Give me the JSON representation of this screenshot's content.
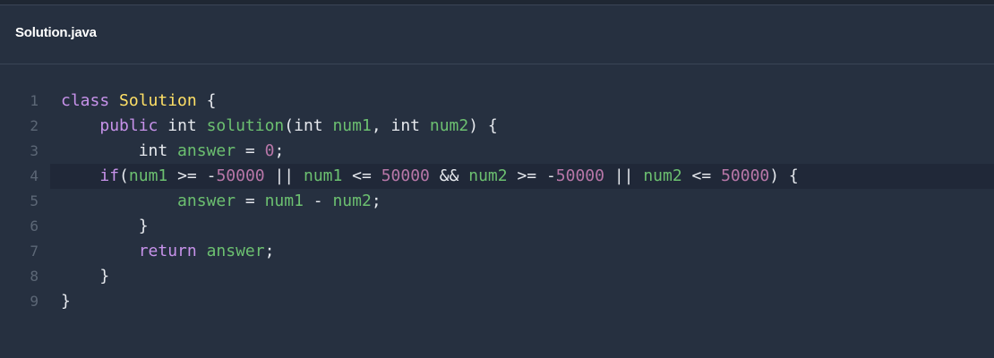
{
  "file": {
    "name": "Solution.java"
  },
  "code": {
    "lines": [
      {
        "n": "1",
        "tokens": [
          {
            "t": "class",
            "c": "kw"
          },
          {
            "t": " ",
            "c": "plain"
          },
          {
            "t": "Solution",
            "c": "cls"
          },
          {
            "t": " {",
            "c": "plain"
          }
        ]
      },
      {
        "n": "2",
        "tokens": [
          {
            "t": "    ",
            "c": "plain"
          },
          {
            "t": "public",
            "c": "kw"
          },
          {
            "t": " int ",
            "c": "plain"
          },
          {
            "t": "solution",
            "c": "fn"
          },
          {
            "t": "(int ",
            "c": "plain"
          },
          {
            "t": "num1",
            "c": "var"
          },
          {
            "t": ", int ",
            "c": "plain"
          },
          {
            "t": "num2",
            "c": "var"
          },
          {
            "t": ") {",
            "c": "plain"
          }
        ]
      },
      {
        "n": "3",
        "tokens": [
          {
            "t": "        int ",
            "c": "plain"
          },
          {
            "t": "answer",
            "c": "var"
          },
          {
            "t": " = ",
            "c": "plain"
          },
          {
            "t": "0",
            "c": "num"
          },
          {
            "t": ";",
            "c": "plain"
          }
        ]
      },
      {
        "n": "4",
        "active": true,
        "tokens": [
          {
            "t": "    ",
            "c": "plain"
          },
          {
            "t": "if",
            "c": "kw"
          },
          {
            "t": "(",
            "c": "plain"
          },
          {
            "t": "num1",
            "c": "var"
          },
          {
            "t": " >= -",
            "c": "plain"
          },
          {
            "t": "50000",
            "c": "num"
          },
          {
            "t": " || ",
            "c": "plain"
          },
          {
            "t": "num1",
            "c": "var"
          },
          {
            "t": " <= ",
            "c": "plain"
          },
          {
            "t": "50000",
            "c": "num"
          },
          {
            "t": " && ",
            "c": "plain"
          },
          {
            "t": "num2",
            "c": "var"
          },
          {
            "t": " >= -",
            "c": "plain"
          },
          {
            "t": "50000",
            "c": "num"
          },
          {
            "t": " || ",
            "c": "plain"
          },
          {
            "t": "num2",
            "c": "var"
          },
          {
            "t": " <= ",
            "c": "plain"
          },
          {
            "t": "50000",
            "c": "num"
          },
          {
            "t": ") {",
            "c": "plain"
          }
        ]
      },
      {
        "n": "5",
        "tokens": [
          {
            "t": "            ",
            "c": "plain"
          },
          {
            "t": "answer",
            "c": "var"
          },
          {
            "t": " = ",
            "c": "plain"
          },
          {
            "t": "num1",
            "c": "var"
          },
          {
            "t": " - ",
            "c": "plain"
          },
          {
            "t": "num2",
            "c": "var"
          },
          {
            "t": ";",
            "c": "plain"
          }
        ]
      },
      {
        "n": "6",
        "tokens": [
          {
            "t": "        }",
            "c": "plain"
          }
        ]
      },
      {
        "n": "7",
        "tokens": [
          {
            "t": "        ",
            "c": "plain"
          },
          {
            "t": "return",
            "c": "kw"
          },
          {
            "t": " ",
            "c": "plain"
          },
          {
            "t": "answer",
            "c": "var"
          },
          {
            "t": ";",
            "c": "plain"
          }
        ]
      },
      {
        "n": "8",
        "tokens": [
          {
            "t": "    }",
            "c": "plain"
          }
        ]
      },
      {
        "n": "9",
        "tokens": [
          {
            "t": "}",
            "c": "plain"
          }
        ]
      }
    ]
  }
}
